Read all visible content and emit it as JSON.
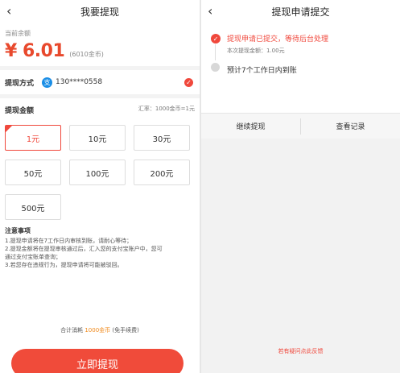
{
  "left": {
    "nav": {
      "back_icon": "‹",
      "title": "我要提现"
    },
    "balance": {
      "label": "当前余额",
      "amount": "¥ 6.01",
      "coins": "(6010金币)"
    },
    "method": {
      "label": "提现方式",
      "account": "130****0558",
      "icon": "alipay-icon"
    },
    "amount_section": {
      "label": "提现金额",
      "rate": "汇率：1000金币=1元"
    },
    "options": [
      "1元",
      "10元",
      "30元",
      "50元",
      "100元",
      "200元",
      "500元"
    ],
    "selected_option": "1元",
    "notes": {
      "title": "注意事项",
      "lines": [
        "1.提现申请将在7工作日内审核到账，请耐心等待；",
        "2.提现金额将在提现审核通过后，汇入您的支付宝账户中，您可",
        "通过支付宝账单查询；",
        "3.若您存在违规行为，提现申请将可能被驳回。"
      ]
    },
    "footer": {
      "total_prefix": "合计消耗",
      "total_value": "1000金币",
      "total_suffix": "(免手续费)",
      "button": "立即提现"
    }
  },
  "right": {
    "nav": {
      "back_icon": "‹",
      "title": "提现申请提交"
    },
    "steps": {
      "step1": "提现申请已提交，等待后台处理",
      "step1_sub": "本次提现金额：1.00元",
      "step2": "预计7个工作日内到账"
    },
    "buttons": {
      "continue": "继续提现",
      "records": "查看记录"
    },
    "feedback": "若有疑问点此反馈"
  },
  "colors": {
    "accent": "#f0483c",
    "amount": "#e8492d",
    "highlight": "#f08a1c",
    "alipay": "#1a8ee6"
  }
}
